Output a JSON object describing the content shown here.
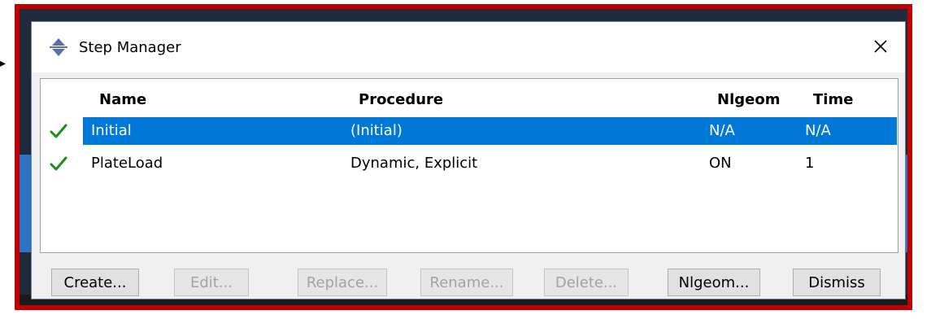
{
  "window": {
    "title": "Step Manager"
  },
  "table": {
    "headers": {
      "name": "Name",
      "procedure": "Procedure",
      "nlgeom": "Nlgeom",
      "time": "Time"
    },
    "rows": [
      {
        "name": "Initial",
        "procedure": "(Initial)",
        "nlgeom": "N/A",
        "time": "N/A",
        "selected": true
      },
      {
        "name": "PlateLoad",
        "procedure": "Dynamic, Explicit",
        "nlgeom": "ON",
        "time": "1",
        "selected": false
      }
    ]
  },
  "buttons": {
    "create": "Create...",
    "edit": "Edit...",
    "replace": "Replace...",
    "rename": "Rename...",
    "delete": "Delete...",
    "nlgeom": "Nlgeom...",
    "dismiss": "Dismiss"
  },
  "icons": {
    "app": "step-manager-icon",
    "close": "close-icon",
    "status": "check-icon"
  },
  "colors": {
    "selection": "#0078d7",
    "check": "#1e8c1e",
    "highlight": "#c00000"
  }
}
